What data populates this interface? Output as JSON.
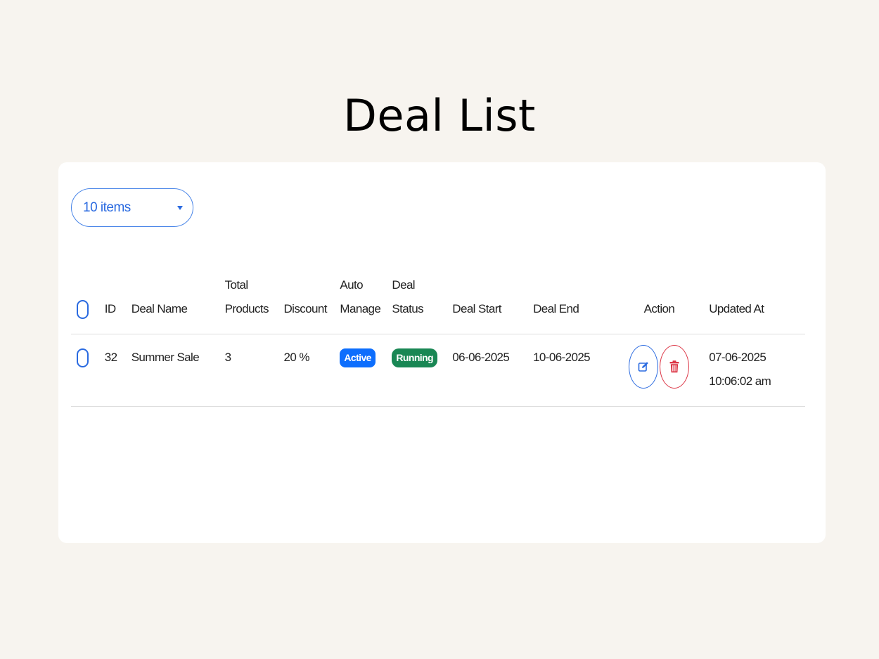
{
  "page": {
    "title": "Deal List"
  },
  "page_size": {
    "selected": "10 items"
  },
  "table": {
    "headers": {
      "id": "ID",
      "deal_name": "Deal Name",
      "total_products_1": "Total",
      "total_products_2": "Products",
      "discount": "Discount",
      "auto_manage_1": "Auto",
      "auto_manage_2": "Manage",
      "deal_status_1": "Deal",
      "deal_status_2": "Status",
      "deal_start": "Deal Start",
      "deal_end": "Deal End",
      "action": "Action",
      "updated_at": "Updated At"
    },
    "rows": [
      {
        "id": "32",
        "deal_name": "Summer Sale",
        "total_products": "3",
        "discount": "20 %",
        "auto_manage": "Active",
        "deal_status": "Running",
        "deal_start": "06-06-2025",
        "deal_end": "10-06-2025",
        "updated_date": "07-06-2025",
        "updated_time": "10:06:02 am"
      }
    ]
  },
  "icons": {
    "edit": "edit-icon",
    "delete": "trash-icon",
    "dropdown": "caret-down-icon"
  },
  "colors": {
    "primary": "#0d6efd",
    "success": "#198754",
    "danger": "#dc3545",
    "background": "#f7f4ef"
  }
}
